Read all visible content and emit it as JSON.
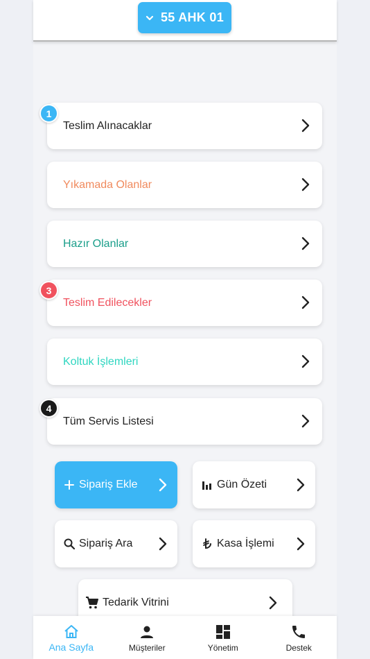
{
  "header": {
    "plate": "55 AHK 01",
    "plate_icon": "chevron-down-icon"
  },
  "status_cards": [
    {
      "label": "Teslim Alınacaklar",
      "color": "#222222",
      "badge": "1",
      "badge_color": "#3bb6f5"
    },
    {
      "label": "Yıkamada Olanlar",
      "color": "#f08a5d",
      "badge": null
    },
    {
      "label": "Hazır Olanlar",
      "color": "#1a9e8a",
      "badge": null
    },
    {
      "label": "Teslim Edilecekler",
      "color": "#f0525e",
      "badge": "3",
      "badge_color": "#f0525e"
    },
    {
      "label": "Koltuk İşlemleri",
      "color": "#2ed6c0",
      "badge": null
    },
    {
      "label": "Tüm Servis Listesi",
      "color": "#222222",
      "badge": "4",
      "badge_color": "#1a1a1a"
    }
  ],
  "actions": {
    "add_order": {
      "label": "Sipariş Ekle",
      "icon": "plus-icon"
    },
    "day_summary": {
      "label": "Gün Özeti",
      "icon": "bar-chart-icon"
    },
    "search_order": {
      "label": "Sipariş Ara",
      "icon": "search-icon"
    },
    "cash_ops": {
      "label": "Kasa İşlemi",
      "icon": "lira-icon"
    },
    "supply_store": {
      "label": "Tedarik Vitrini",
      "icon": "cart-icon"
    }
  },
  "bottom_nav": [
    {
      "label": "Ana Sayfa",
      "icon": "home-icon",
      "active": true
    },
    {
      "label": "Müşteriler",
      "icon": "person-icon",
      "active": false
    },
    {
      "label": "Yönetim",
      "icon": "dashboard-icon",
      "active": false
    },
    {
      "label": "Destek",
      "icon": "phone-icon",
      "active": false
    }
  ],
  "colors": {
    "accent": "#3bb6f5"
  }
}
